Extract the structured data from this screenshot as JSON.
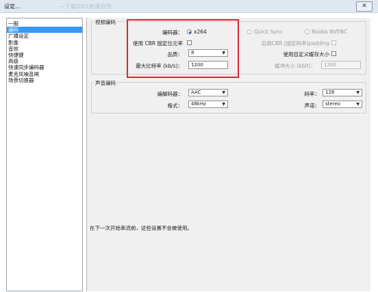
{
  "window": {
    "title": "设定...",
    "overlay_title": "—下载OBS直播软件",
    "close_label": "✕"
  },
  "sidebar": {
    "items": [
      {
        "label": "一般",
        "selected": false
      },
      {
        "label": "编码",
        "selected": true
      },
      {
        "label": "广播设定",
        "selected": false
      },
      {
        "label": "影像",
        "selected": false
      },
      {
        "label": "音效",
        "selected": false
      },
      {
        "label": "快捷键",
        "selected": false
      },
      {
        "label": "高级",
        "selected": false
      },
      {
        "label": "快速同步编码器",
        "selected": false
      },
      {
        "label": "麦克风噪音闸",
        "selected": false
      },
      {
        "label": "场景切换器",
        "selected": false
      }
    ]
  },
  "video": {
    "group_label": "视频编码",
    "encoder_label": "编码器：",
    "encoder_x264": "x264",
    "encoder_quicksync": "Quick Sync",
    "encoder_nvenc": "Nvidia NVENC",
    "cbr_label": "使用 CBR 固定位元率",
    "cbr_padding_label": "启用CBR (固定码率)padding",
    "quality_label": "品质：",
    "quality_value": "8",
    "custom_buffer_label": "使用自定义缓存大小",
    "max_bitrate_label": "最大比特率 (kb/s)：",
    "max_bitrate_value": "1200",
    "buffer_size_label": "缓冲大小 (kbit)：",
    "buffer_size_value": "1200"
  },
  "audio": {
    "group_label": "声音编码",
    "codec_label": "编解码器：",
    "codec_value": "AAC",
    "bitrate_label": "码率：",
    "bitrate_value": "128",
    "format_label": "格式：",
    "format_value": "48kHz",
    "channel_label": "声道：",
    "channel_value": "stereo"
  },
  "footer_note": "在下一次开始串流前，这些设置不会被使用。",
  "colors": {
    "selection": "#3399ff",
    "highlight_box": "#d7282f",
    "panel_bg": "#f0f0f0"
  }
}
